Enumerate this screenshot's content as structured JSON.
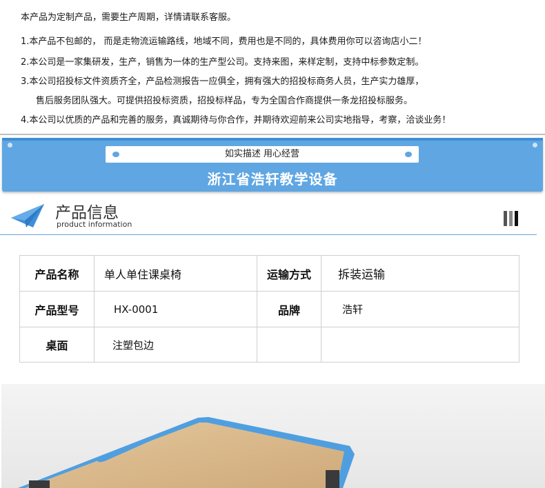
{
  "notes": [
    "本产品为定制产品，需要生产周期，详情请联系客服。",
    "1.本产品不包邮的， 而是走物流运输路线，地域不同，费用也是不同的，具体费用你可以咨询店小二！",
    "2.本公司是一家集研发，生产，销售为一体的生产型公司。支持来图，来样定制，支持中标参数定制。",
    "3.本公司招投标文件资质齐全，产品检测报告一应俱全，拥有强大的招投标商务人员，生产实力雄厚，",
    "售后服务团队强大。可提供招投标资质，招投标样品，专为全国合作商提供一条龙招投标服务。",
    "4.本公司以优质的产品和完善的服务，真诚期待与你合作，并期待欢迎前来公司实地指导，考察，洽谈业务！"
  ],
  "banner": {
    "slogan": "如实描述 用心经营",
    "company": "浙江省浩轩教学设备"
  },
  "info_header": {
    "title": "产品信息",
    "subtitle": "product information"
  },
  "spec_table": {
    "rows": [
      [
        "产品名称",
        "单人单住课桌椅",
        "运输方式",
        "拆装运输"
      ],
      [
        "产品型号",
        "HX-0001",
        "品牌",
        "浩轩"
      ],
      [
        "桌面",
        "注塑包边",
        "",
        ""
      ]
    ]
  },
  "colors": {
    "banner_blue": "#5fa6e3",
    "desk_edge_blue": "#4f9fe0",
    "desk_wood": "#d9b98a"
  }
}
